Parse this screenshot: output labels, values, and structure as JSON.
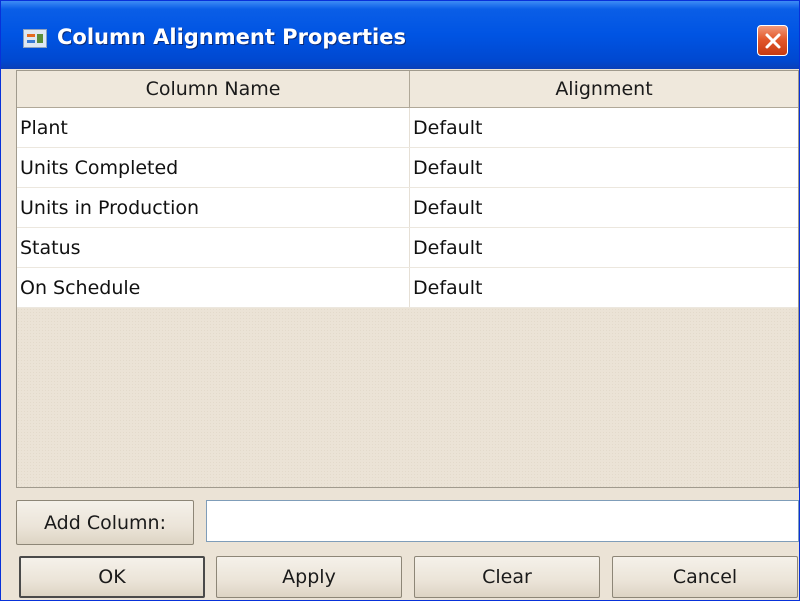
{
  "window": {
    "title": "Column Alignment Properties",
    "title_icon": "table-properties-icon",
    "close_icon": "close-icon"
  },
  "table": {
    "columns": [
      "Column Name",
      "Alignment"
    ],
    "rows": [
      [
        "Plant",
        "Default"
      ],
      [
        "Units Completed",
        "Default"
      ],
      [
        "Units in Production",
        "Default"
      ],
      [
        "Status",
        "Default"
      ],
      [
        "On Schedule",
        "Default"
      ]
    ]
  },
  "add_column": {
    "button_label": "Add Column:",
    "value": "",
    "placeholder": ""
  },
  "buttons": {
    "ok": "OK",
    "apply": "Apply",
    "clear": "Clear",
    "cancel": "Cancel"
  },
  "colors": {
    "titlebar": "#0054e3",
    "close": "#e3592c",
    "dialog_bg": "#ebe3d6"
  }
}
